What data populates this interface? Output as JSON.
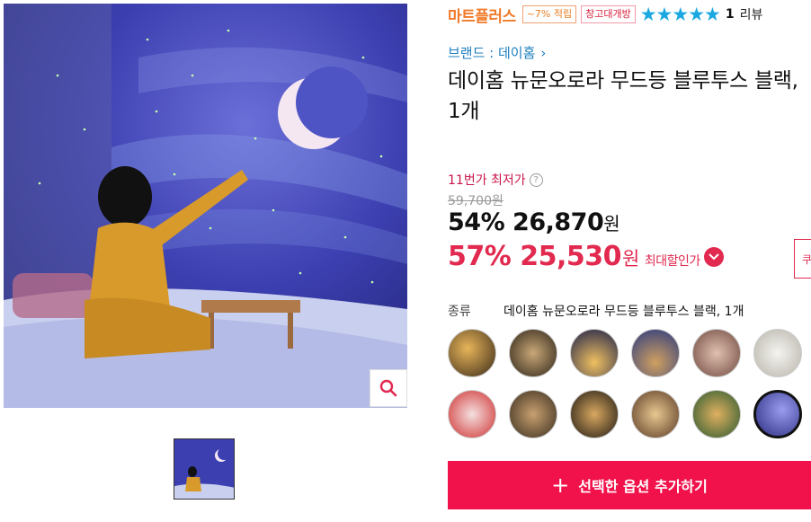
{
  "header": {
    "mart_label": "마트플러스",
    "tag_points": "~7% 적립",
    "tag_warehouse": "창고대개방",
    "rating_stars": 5,
    "review_count": "1",
    "review_label": "리뷰"
  },
  "brand": {
    "label": "브랜드 : 데이홈"
  },
  "product": {
    "title": "데이홈 뉴문오로라 무드등 블루투스 블랙, 1개"
  },
  "price": {
    "lowest_label": "11번가 최저가",
    "original": "59,700원",
    "discount1": "54%",
    "price1": "26,870",
    "won": "원",
    "discount2": "57%",
    "price2": "25,530",
    "max_label": "최대할인가",
    "side_button": "쿠"
  },
  "option": {
    "label": "종류",
    "value": "데이홈 뉴문오로라 무드등 블루투스 블랙, 1개",
    "swatch_count": 12,
    "selected_index": 11
  },
  "actions": {
    "add_label": "선택한 옵션 추가하기"
  },
  "colors": {
    "accent": "#f2124b",
    "mart": "#f07a2a",
    "star": "#1ba8e0",
    "brand_link": "#1f7fbf"
  }
}
